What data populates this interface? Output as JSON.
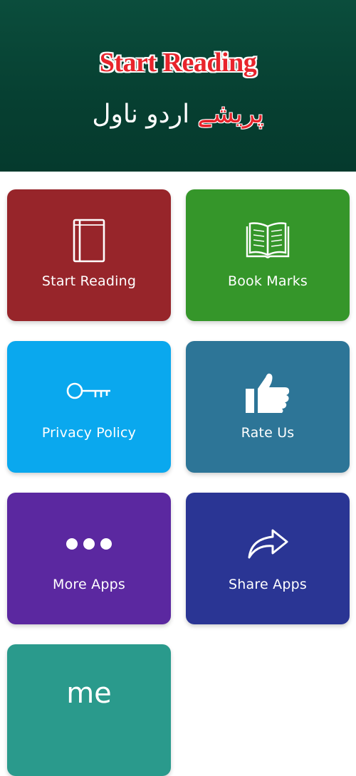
{
  "header": {
    "title": "Start Reading",
    "subtitle_prefix": "پریشے",
    "subtitle_main": " اردو ناول"
  },
  "tiles": [
    {
      "label": "Start Reading",
      "icon": "book-icon",
      "color": "#97252a"
    },
    {
      "label": "Book Marks",
      "icon": "open-book-icon",
      "color": "#35962a"
    },
    {
      "label": "Privacy Policy",
      "icon": "key-icon",
      "color": "#0aa8ee"
    },
    {
      "label": "Rate Us",
      "icon": "thumbs-up-icon",
      "color": "#2d7597"
    },
    {
      "label": "More Apps",
      "icon": "more-dots-icon",
      "color": "#5b28a0"
    },
    {
      "label": "Share Apps",
      "icon": "share-arrow-icon",
      "color": "#2a3594"
    },
    {
      "label": "me",
      "icon": "",
      "color": "#2a9a8c"
    }
  ]
}
